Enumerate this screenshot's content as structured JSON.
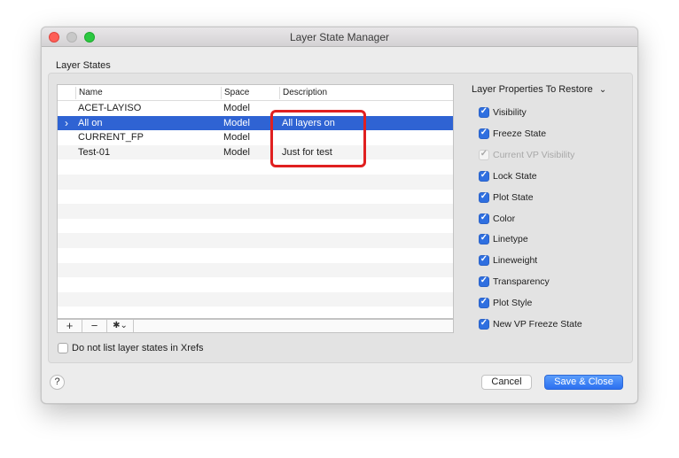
{
  "window": {
    "title": "Layer State Manager"
  },
  "layer_states": {
    "group_label": "Layer States",
    "columns": [
      "Name",
      "Space",
      "Description"
    ],
    "rows": [
      {
        "name": "ACET-LAYISO",
        "space": "Model",
        "description": ""
      },
      {
        "name": "All on",
        "space": "Model",
        "description": "All layers on"
      },
      {
        "name": "CURRENT_FP",
        "space": "Model",
        "description": ""
      },
      {
        "name": "Test-01",
        "space": "Model",
        "description": "Just for test"
      }
    ],
    "selected_index": 1,
    "toolbar": {
      "add": "+",
      "remove": "−",
      "gear": "✱⌄"
    }
  },
  "xrefs_option": {
    "label": "Do not list layer states in Xrefs",
    "checked": false
  },
  "properties": {
    "title": "Layer Properties To Restore",
    "items": [
      {
        "label": "Visibility",
        "checked": true,
        "enabled": true
      },
      {
        "label": "Freeze State",
        "checked": true,
        "enabled": true
      },
      {
        "label": "Current VP Visibility",
        "checked": true,
        "enabled": false
      },
      {
        "label": "Lock State",
        "checked": true,
        "enabled": true
      },
      {
        "label": "Plot State",
        "checked": true,
        "enabled": true
      },
      {
        "label": "Color",
        "checked": true,
        "enabled": true
      },
      {
        "label": "Linetype",
        "checked": true,
        "enabled": true
      },
      {
        "label": "Lineweight",
        "checked": true,
        "enabled": true
      },
      {
        "label": "Transparency",
        "checked": true,
        "enabled": true
      },
      {
        "label": "Plot Style",
        "checked": true,
        "enabled": true
      },
      {
        "label": "New VP Freeze State",
        "checked": true,
        "enabled": true
      }
    ]
  },
  "buttons": {
    "help": "?",
    "cancel": "Cancel",
    "save_close": "Save & Close"
  },
  "colors": {
    "selection": "#2f63d3",
    "accent": "#2f6fe0",
    "annotation": "#e02020"
  }
}
